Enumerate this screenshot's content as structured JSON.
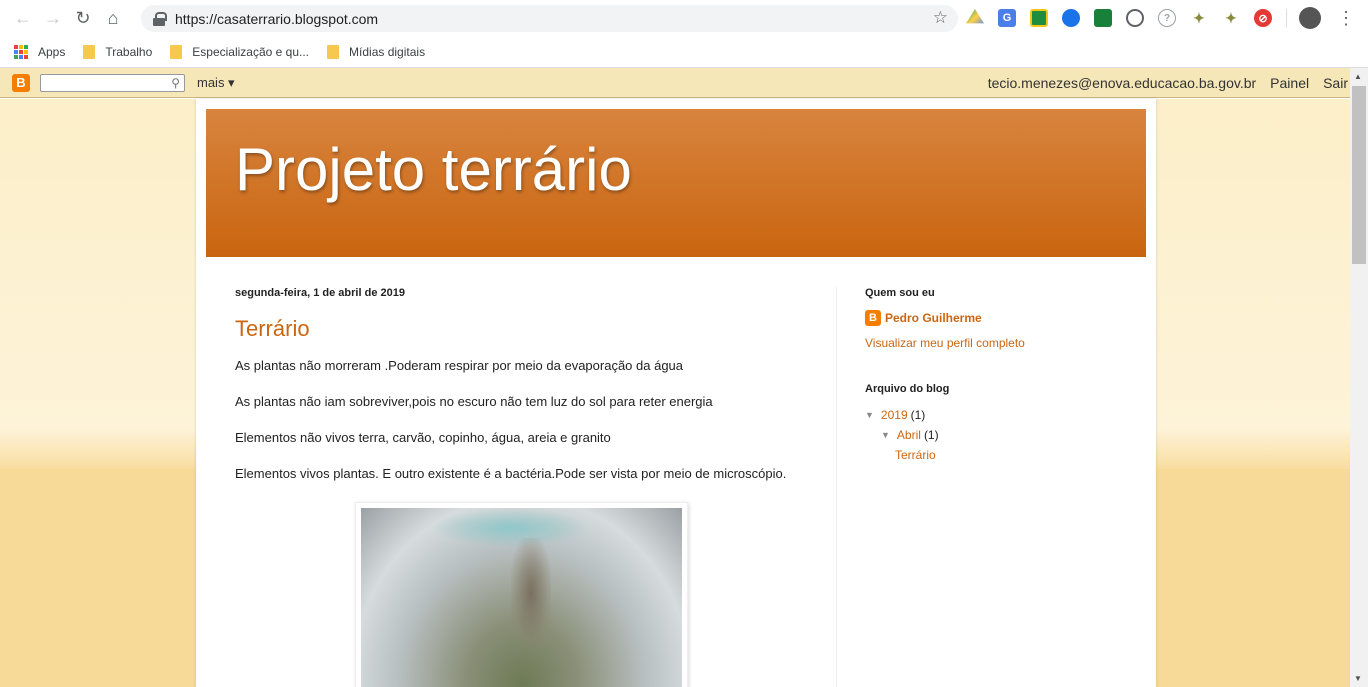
{
  "browser": {
    "url": "https://casaterrario.blogspot.com",
    "bookmarks": [
      {
        "label": "Apps"
      },
      {
        "label": "Trabalho"
      },
      {
        "label": "Especialização e qu..."
      },
      {
        "label": "Mídias digitais"
      }
    ],
    "icons": {
      "back": "back-arrow-icon",
      "forward": "forward-arrow-icon",
      "reload": "reload-icon",
      "home": "home-icon",
      "lock": "lock-icon",
      "star": "star-icon",
      "menu": "kebab-menu-icon"
    }
  },
  "blogger_nav": {
    "more": "mais ▾",
    "user": "tecio.menezes@enova.educacao.ba.gov.br",
    "dashboard": "Painel",
    "logout": "Sair"
  },
  "blog": {
    "title": "Projeto terrário",
    "post": {
      "date": "segunda-feira, 1 de abril de 2019",
      "title": "Terrário",
      "paragraphs": [
        "As plantas não morreram .Poderam respirar por meio da evaporação da água",
        "As plantas não iam sobreviver,pois no escuro não tem luz do sol para reter energia",
        "Elementos não vivos terra, carvão, copinho, água, areia e granito",
        "Elementos vivos plantas. E outro existente é a bactéria.Pode ser vista por meio de microscópio."
      ]
    },
    "sidebar": {
      "about_title": "Quem sou eu",
      "author": "Pedro Guilherme",
      "full_profile": "Visualizar meu perfil completo",
      "archive_title": "Arquivo do blog",
      "archive": {
        "year": "2019",
        "year_count": "(1)",
        "month": "Abril",
        "month_count": "(1)",
        "post": "Terrário"
      }
    }
  },
  "colors": {
    "accent": "#cc6611",
    "header_top": "#d8843e",
    "header_bottom": "#c96510",
    "navbar_bg": "#f6e7b8"
  }
}
